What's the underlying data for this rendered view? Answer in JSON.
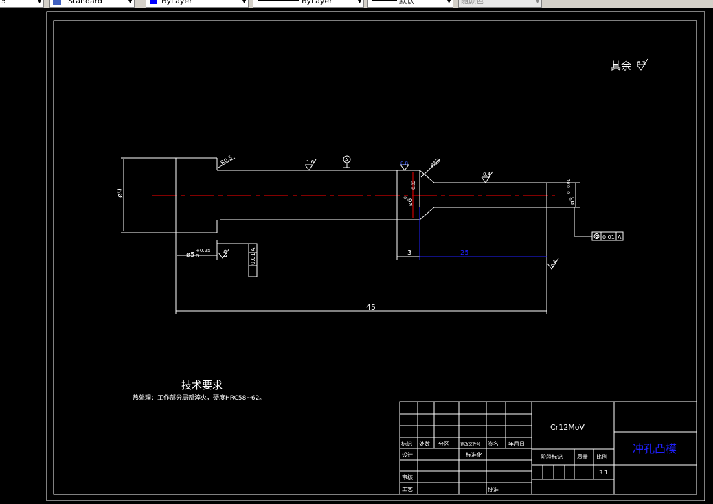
{
  "toolbar": {
    "combo0": "5",
    "text_style": "Standard",
    "color": "ByLayer",
    "color_swatch": "#0000ff",
    "linetype": "ByLayer",
    "lineweight": "默认",
    "plot_style": "随颜色"
  },
  "drawing": {
    "roughness_note": "其余",
    "roughness_note_value": "6.3",
    "dims": {
      "dia9": "ø9",
      "dia5": "ø5",
      "dia5_tol_upper": "+0.25",
      "dia5_tol_lower": "0",
      "dia6": "ø6",
      "dia6_tol_upper": "0",
      "dia6_tol_lower": "-0.02",
      "dia3": "ø3",
      "dia3_tol_upper": "0",
      "dia3_tol_lower": "-0.01",
      "len3": "3",
      "len25": "25",
      "len45": "45",
      "r05": "R0.5",
      "r13": "R13"
    },
    "roughness": {
      "r15": "1.6",
      "r08": "0.8",
      "r04": "0.4",
      "r16": "1.6",
      "r04b": "0.4"
    },
    "datum": "A",
    "tolerance_right": {
      "value": "0.01",
      "datum": "A"
    },
    "tolerance_left": {
      "value": "0.01",
      "datum": "A"
    },
    "tech_req_title": "技术要求",
    "tech_req_text": "热处理：工作部分局部淬火，硬度HRC58~62。"
  },
  "title_block": {
    "material": "Cr12MoV",
    "part_name": "冲孔凸模",
    "header_row": [
      "标记",
      "处数",
      "分区",
      "更改文件号",
      "签名",
      "年月日"
    ],
    "design": "设计",
    "standardize": "标准化",
    "check": "审核",
    "process": "工艺",
    "approve": "批准",
    "stage_mark": "阶段标记",
    "weight": "质量",
    "scale": "比例",
    "scale_value": "3:1"
  }
}
